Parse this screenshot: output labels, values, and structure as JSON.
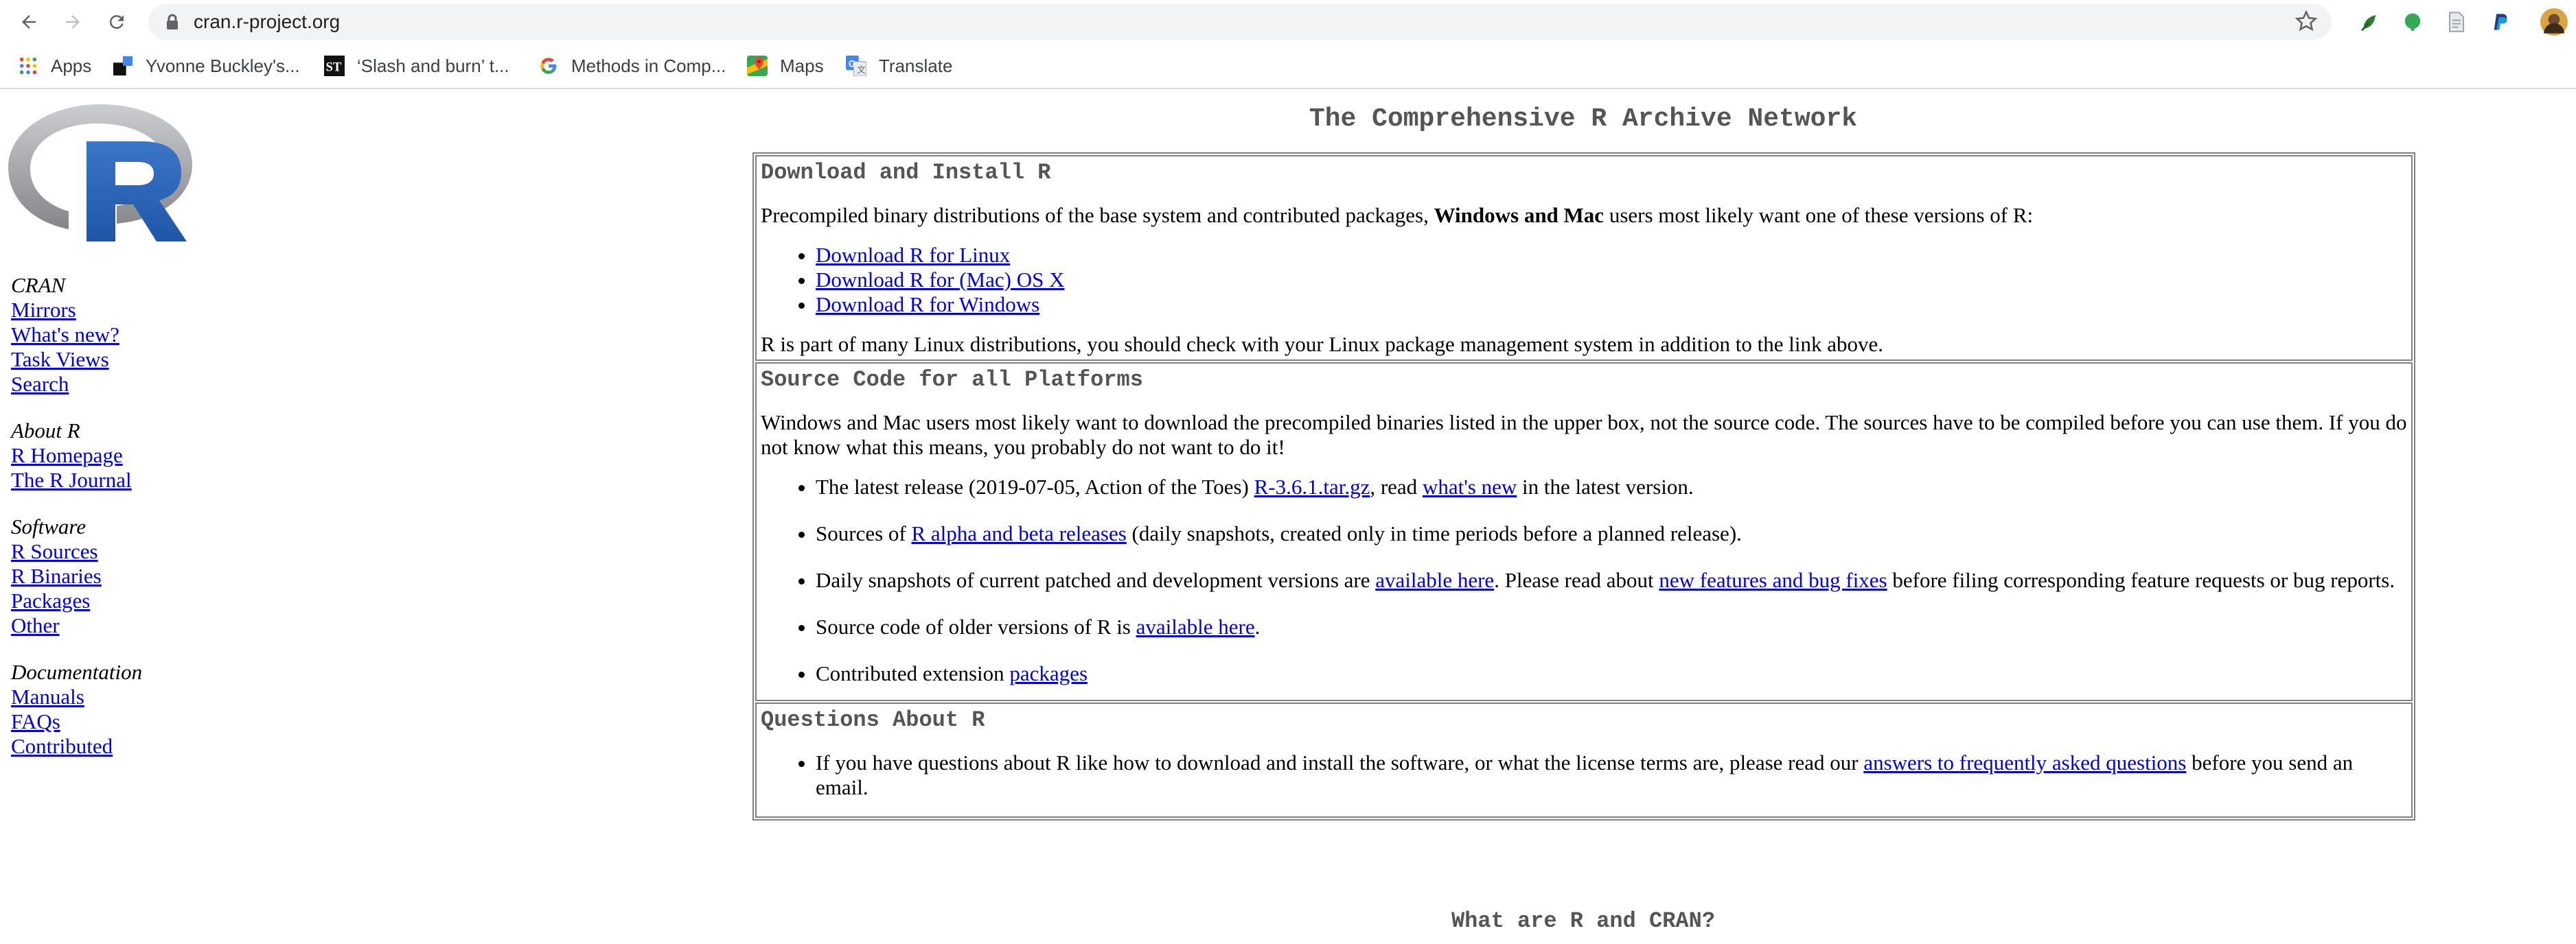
{
  "browser": {
    "url": "cran.r-project.org",
    "bookmarks": [
      {
        "label": "Apps",
        "icon": "apps-grid-icon"
      },
      {
        "label": "Yvonne Buckley's...",
        "icon": "site-favicon-icon"
      },
      {
        "label": "‘Slash and burn’ t...",
        "icon": "st-favicon-icon"
      },
      {
        "label": "Methods in Comp...",
        "icon": "google-icon"
      },
      {
        "label": "Maps",
        "icon": "maps-icon"
      },
      {
        "label": "Translate",
        "icon": "translate-icon"
      }
    ]
  },
  "sidebar": {
    "groups": [
      {
        "heading": "CRAN",
        "links": [
          "Mirrors",
          "What's new?",
          "Task Views",
          "Search"
        ]
      },
      {
        "heading": "About R",
        "links": [
          "R Homepage",
          "The R Journal"
        ]
      },
      {
        "heading": "Software",
        "links": [
          "R Sources",
          "R Binaries",
          "Packages",
          "Other"
        ]
      },
      {
        "heading": "Documentation",
        "links": [
          "Manuals",
          "FAQs",
          "Contributed"
        ]
      }
    ]
  },
  "main": {
    "title": "The Comprehensive R Archive Network",
    "download": {
      "heading": "Download and Install R",
      "intro_before": "Precompiled binary distributions of the base system and contributed packages, ",
      "intro_bold": "Windows and Mac",
      "intro_after": " users most likely want one of these versions of R:",
      "links": [
        "Download R for Linux",
        "Download R for (Mac) OS X",
        "Download R for Windows"
      ],
      "note": "R is part of many Linux distributions, you should check with your Linux package management system in addition to the link above."
    },
    "source": {
      "heading": "Source Code for all Platforms",
      "intro": "Windows and Mac users most likely want to download the precompiled binaries listed in the upper box, not the source code. The sources have to be compiled before you can use them. If you do not know what this means, you probably do not want to do it!",
      "item1_a": "The latest release (2019-07-05, Action of the Toes) ",
      "item1_link1": "R-3.6.1.tar.gz",
      "item1_b": ", read ",
      "item1_link2": "what's new",
      "item1_c": " in the latest version.",
      "item2_a": "Sources of ",
      "item2_link": "R alpha and beta releases",
      "item2_b": " (daily snapshots, created only in time periods before a planned release).",
      "item3_a": "Daily snapshots of current patched and development versions are ",
      "item3_link1": "available here",
      "item3_b": ". Please read about ",
      "item3_link2": "new features and bug fixes",
      "item3_c": " before filing corresponding feature requests or bug reports.",
      "item4_a": "Source code of older versions of R is ",
      "item4_link": "available here",
      "item4_b": ".",
      "item5_a": "Contributed extension ",
      "item5_link": "packages"
    },
    "questions": {
      "heading": "Questions About R",
      "item_a": "If you have questions about R like how to download and install the software, or what the license terms are, please read our ",
      "item_link": "answers to frequently asked questions",
      "item_b": " before you send an email."
    },
    "subtitle": "What are R and CRAN?"
  }
}
